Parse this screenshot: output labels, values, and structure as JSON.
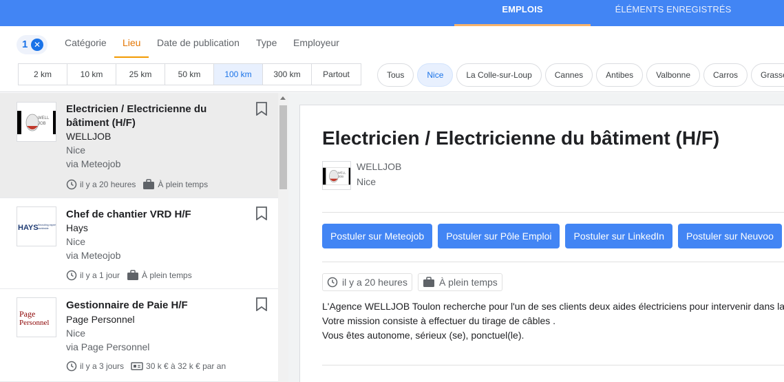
{
  "header": {
    "tabs": [
      {
        "label": "EMPLOIS",
        "active": true
      },
      {
        "label": "ÉLÉMENTS ENREGISTRÉS",
        "active": false
      }
    ],
    "accent": "#4285f4"
  },
  "filters": {
    "count": "1",
    "clear_icon": "close-icon",
    "tabs": [
      "Catégorie",
      "Lieu",
      "Date de publication",
      "Type",
      "Employeur"
    ],
    "active_tab": "Lieu",
    "distances": [
      "2 km",
      "10 km",
      "25 km",
      "50 km",
      "100 km",
      "300 km",
      "Partout"
    ],
    "selected_distance": "100 km",
    "cities": [
      "Tous",
      "Nice",
      "La Colle-sur-Loup",
      "Cannes",
      "Antibes",
      "Valbonne",
      "Carros",
      "Grasse"
    ],
    "selected_city": "Nice"
  },
  "jobs": [
    {
      "title": "Electricien / Electricienne du bâtiment (H/F)",
      "company": "WELLJOB",
      "location": "Nice",
      "via": "via Meteojob",
      "posted": "il y a 20 heures",
      "type": "À plein temps",
      "selected": true
    },
    {
      "title": "Chef de chantier VRD H/F",
      "company": "Hays",
      "location": "Nice",
      "via": "via Meteojob",
      "posted": "il y a 1 jour",
      "type": "À plein temps"
    },
    {
      "title": "Gestionnaire de Paie H/F",
      "company": "Page Personnel",
      "location": "Nice",
      "via": "via Page Personnel",
      "posted": "il y a 3 jours",
      "salary": "30 k € à 32 k € par an"
    }
  ],
  "detail": {
    "title": "Electricien / Electricienne du bâtiment (H/F)",
    "company": "WELLJOB",
    "location": "Nice",
    "apply_buttons": [
      "Postuler sur Meteojob",
      "Postuler sur Pôle Emploi",
      "Postuler sur LinkedIn",
      "Postuler sur Neuvoo"
    ],
    "posted": "il y a 20 heures",
    "type": "À plein temps",
    "description": [
      "L'Agence WELLJOB Toulon recherche pour l'un de ses clients deux aides électriciens pour intervenir dans la c",
      "Votre mission consiste à effectuer du tirage de câbles .",
      "Vous êtes autonome, sérieux (se), ponctuel(le)."
    ]
  },
  "logos": {
    "welljob_text": "WELL JOB",
    "hays_text": "HAYS",
    "hays_tagline": "Recruiting experts worldwide",
    "page_personnel_line1": "Page",
    "page_personnel_line2": "Personnel"
  }
}
